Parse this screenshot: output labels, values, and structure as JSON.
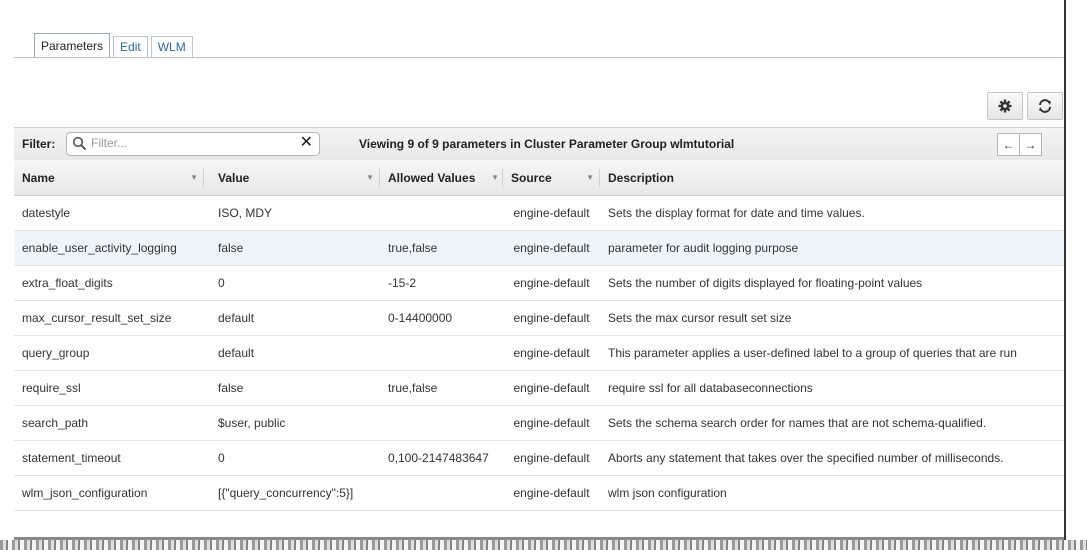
{
  "tabs": [
    {
      "label": "Parameters",
      "active": true
    },
    {
      "label": "Edit",
      "active": false
    },
    {
      "label": "WLM",
      "active": false
    }
  ],
  "toolbar": {
    "settings_icon": "gear-icon",
    "refresh_icon": "refresh-icon"
  },
  "filter": {
    "label": "Filter:",
    "placeholder": "Filter...",
    "value": "",
    "clear_glyph": "✕"
  },
  "viewing_text": "Viewing 9 of 9 parameters in Cluster Parameter Group wlmtutorial",
  "pager": {
    "prev": "←",
    "next": "→"
  },
  "table": {
    "columns": [
      "Name",
      "Value",
      "Allowed Values",
      "Source",
      "Description"
    ],
    "rows": [
      [
        "datestyle",
        "ISO, MDY",
        "",
        "engine-default",
        "Sets the display format for date and time values."
      ],
      [
        "enable_user_activity_logging",
        "false",
        "true,false",
        "engine-default",
        "parameter for audit logging purpose"
      ],
      [
        "extra_float_digits",
        "0",
        "-15-2",
        "engine-default",
        "Sets the number of digits displayed for floating-point values"
      ],
      [
        "max_cursor_result_set_size",
        "default",
        "0-14400000",
        "engine-default",
        "Sets the max cursor result set size"
      ],
      [
        "query_group",
        "default",
        "",
        "engine-default",
        "This parameter applies a user-defined label to a group of queries that are run"
      ],
      [
        "require_ssl",
        "false",
        "true,false",
        "engine-default",
        "require ssl for all databaseconnections"
      ],
      [
        "search_path",
        "$user, public",
        "",
        "engine-default",
        "Sets the schema search order for names that are not schema-qualified."
      ],
      [
        "statement_timeout",
        "0",
        "0,100-2147483647",
        "engine-default",
        "Aborts any statement that takes over the specified number of milliseconds."
      ],
      [
        "wlm_json_configuration",
        "[{\"query_concurrency\":5}]",
        "",
        "engine-default",
        "wlm json configuration"
      ]
    ]
  },
  "colors": {
    "link": "#2a66b8",
    "highlight_row": "#eef5fb"
  }
}
